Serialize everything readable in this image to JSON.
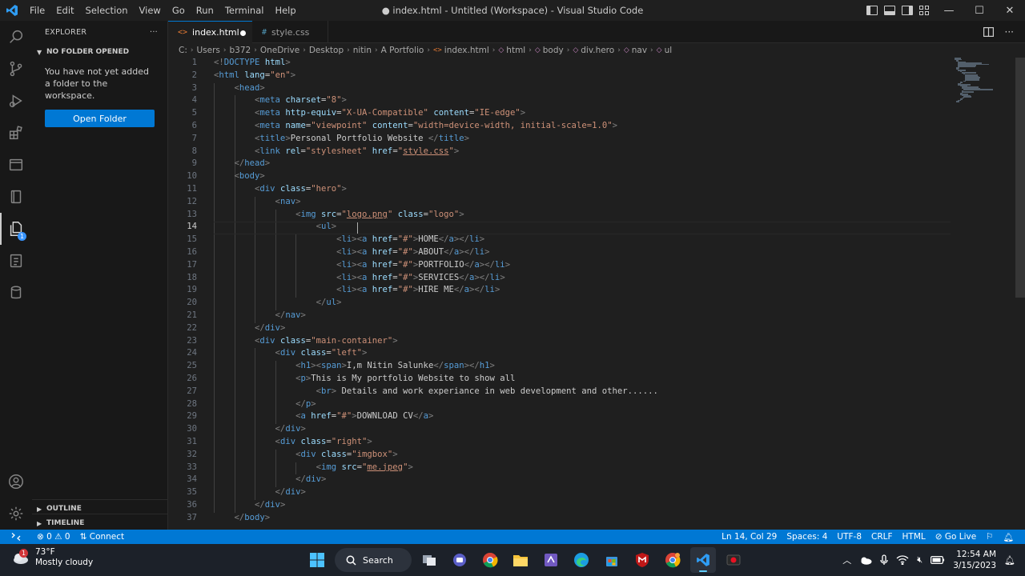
{
  "titlebar": {
    "menu": [
      "File",
      "Edit",
      "Selection",
      "View",
      "Go",
      "Run",
      "Terminal",
      "Help"
    ],
    "window_title": "● index.html - Untitled (Workspace) - Visual Studio Code",
    "minimize": "—",
    "maximize": "☐",
    "close": "✕"
  },
  "sidebar": {
    "header": "EXPLORER",
    "more": "···",
    "section": "NO FOLDER OPENED",
    "message": "You have not yet added a folder to the workspace.",
    "open_folder": "Open Folder",
    "outline": "OUTLINE",
    "timeline": "TIMELINE"
  },
  "activity": {
    "explorer_badge": "1"
  },
  "tabs": [
    {
      "icon": "<>",
      "label": "index.html"
    },
    {
      "icon": "#",
      "label": "style.css"
    }
  ],
  "breadcrumb": {
    "path": [
      "C:",
      "Users",
      "b372",
      "OneDrive",
      "Desktop",
      "nitin",
      "A Portfolio"
    ],
    "file": "index.html",
    "symbols": [
      "html",
      "body",
      "div.hero",
      "nav",
      "ul"
    ]
  },
  "editor": {
    "current_line": 14,
    "lines": [
      [
        [
          "p",
          "<!"
        ],
        [
          "t",
          "DOCTYPE"
        ],
        [
          "x",
          " "
        ],
        [
          "a",
          "html"
        ],
        [
          "p",
          ">"
        ]
      ],
      [
        [
          "p",
          "<"
        ],
        [
          "t",
          "html"
        ],
        [
          "x",
          " "
        ],
        [
          "a",
          "lang"
        ],
        [
          "x",
          "="
        ],
        [
          "s",
          "\"en\""
        ],
        [
          "p",
          ">"
        ]
      ],
      [
        [
          "x",
          "    "
        ],
        [
          "p",
          "<"
        ],
        [
          "t",
          "head"
        ],
        [
          "p",
          ">"
        ]
      ],
      [
        [
          "x",
          "        "
        ],
        [
          "p",
          "<"
        ],
        [
          "t",
          "meta"
        ],
        [
          "x",
          " "
        ],
        [
          "a",
          "charset"
        ],
        [
          "x",
          "="
        ],
        [
          "s",
          "\"8\""
        ],
        [
          "p",
          ">"
        ]
      ],
      [
        [
          "x",
          "        "
        ],
        [
          "p",
          "<"
        ],
        [
          "t",
          "meta"
        ],
        [
          "x",
          " "
        ],
        [
          "a",
          "http-equiv"
        ],
        [
          "x",
          "="
        ],
        [
          "s",
          "\"X-UA-Compatible\""
        ],
        [
          "x",
          " "
        ],
        [
          "a",
          "content"
        ],
        [
          "x",
          "="
        ],
        [
          "s",
          "\"IE-edge\""
        ],
        [
          "p",
          ">"
        ]
      ],
      [
        [
          "x",
          "        "
        ],
        [
          "p",
          "<"
        ],
        [
          "t",
          "meta"
        ],
        [
          "x",
          " "
        ],
        [
          "a",
          "name"
        ],
        [
          "x",
          "="
        ],
        [
          "s",
          "\"viewpoint\""
        ],
        [
          "x",
          " "
        ],
        [
          "a",
          "content"
        ],
        [
          "x",
          "="
        ],
        [
          "s",
          "\"width=device-width, initial-scale=1.0\""
        ],
        [
          "p",
          ">"
        ]
      ],
      [
        [
          "x",
          "        "
        ],
        [
          "p",
          "<"
        ],
        [
          "t",
          "title"
        ],
        [
          "p",
          ">"
        ],
        [
          "x",
          "Personal Portfolio Website "
        ],
        [
          "p",
          "</"
        ],
        [
          "t",
          "title"
        ],
        [
          "p",
          ">"
        ]
      ],
      [
        [
          "x",
          "        "
        ],
        [
          "p",
          "<"
        ],
        [
          "t",
          "link"
        ],
        [
          "x",
          " "
        ],
        [
          "a",
          "rel"
        ],
        [
          "x",
          "="
        ],
        [
          "s",
          "\"stylesheet\""
        ],
        [
          "x",
          " "
        ],
        [
          "a",
          "href"
        ],
        [
          "x",
          "="
        ],
        [
          "s",
          "\""
        ],
        [
          "su",
          "style.css"
        ],
        [
          "s",
          "\""
        ],
        [
          "p",
          ">"
        ]
      ],
      [
        [
          "x",
          "    "
        ],
        [
          "p",
          "</"
        ],
        [
          "t",
          "head"
        ],
        [
          "p",
          ">"
        ]
      ],
      [
        [
          "x",
          "    "
        ],
        [
          "p",
          "<"
        ],
        [
          "t",
          "body"
        ],
        [
          "p",
          ">"
        ]
      ],
      [
        [
          "x",
          "        "
        ],
        [
          "p",
          "<"
        ],
        [
          "t",
          "div"
        ],
        [
          "x",
          " "
        ],
        [
          "a",
          "class"
        ],
        [
          "x",
          "="
        ],
        [
          "s",
          "\"hero\""
        ],
        [
          "p",
          ">"
        ]
      ],
      [
        [
          "x",
          "            "
        ],
        [
          "p",
          "<"
        ],
        [
          "t",
          "nav"
        ],
        [
          "p",
          ">"
        ]
      ],
      [
        [
          "x",
          "                "
        ],
        [
          "p",
          "<"
        ],
        [
          "t",
          "img"
        ],
        [
          "x",
          " "
        ],
        [
          "a",
          "src"
        ],
        [
          "x",
          "="
        ],
        [
          "s",
          "\""
        ],
        [
          "su",
          "logo.png"
        ],
        [
          "s",
          "\""
        ],
        [
          "x",
          " "
        ],
        [
          "a",
          "class"
        ],
        [
          "x",
          "="
        ],
        [
          "s",
          "\"logo\""
        ],
        [
          "p",
          ">"
        ]
      ],
      [
        [
          "x",
          "                    "
        ],
        [
          "p",
          "<"
        ],
        [
          "t",
          "ul"
        ],
        [
          "p",
          ">"
        ]
      ],
      [
        [
          "x",
          "                        "
        ],
        [
          "p",
          "<"
        ],
        [
          "t",
          "li"
        ],
        [
          "p",
          "><"
        ],
        [
          "t",
          "a"
        ],
        [
          "x",
          " "
        ],
        [
          "a",
          "href"
        ],
        [
          "x",
          "="
        ],
        [
          "s",
          "\"#\""
        ],
        [
          "p",
          ">"
        ],
        [
          "x",
          "HOME"
        ],
        [
          "p",
          "</"
        ],
        [
          "t",
          "a"
        ],
        [
          "p",
          "></"
        ],
        [
          "t",
          "li"
        ],
        [
          "p",
          ">"
        ]
      ],
      [
        [
          "x",
          "                        "
        ],
        [
          "p",
          "<"
        ],
        [
          "t",
          "li"
        ],
        [
          "p",
          "><"
        ],
        [
          "t",
          "a"
        ],
        [
          "x",
          " "
        ],
        [
          "a",
          "href"
        ],
        [
          "x",
          "="
        ],
        [
          "s",
          "\"#\""
        ],
        [
          "p",
          ">"
        ],
        [
          "x",
          "ABOUT"
        ],
        [
          "p",
          "</"
        ],
        [
          "t",
          "a"
        ],
        [
          "p",
          "></"
        ],
        [
          "t",
          "li"
        ],
        [
          "p",
          ">"
        ]
      ],
      [
        [
          "x",
          "                        "
        ],
        [
          "p",
          "<"
        ],
        [
          "t",
          "li"
        ],
        [
          "p",
          "><"
        ],
        [
          "t",
          "a"
        ],
        [
          "x",
          " "
        ],
        [
          "a",
          "href"
        ],
        [
          "x",
          "="
        ],
        [
          "s",
          "\"#\""
        ],
        [
          "p",
          ">"
        ],
        [
          "x",
          "PORTFOLIO"
        ],
        [
          "p",
          "</"
        ],
        [
          "t",
          "a"
        ],
        [
          "p",
          "></"
        ],
        [
          "t",
          "li"
        ],
        [
          "p",
          ">"
        ]
      ],
      [
        [
          "x",
          "                        "
        ],
        [
          "p",
          "<"
        ],
        [
          "t",
          "li"
        ],
        [
          "p",
          "><"
        ],
        [
          "t",
          "a"
        ],
        [
          "x",
          " "
        ],
        [
          "a",
          "href"
        ],
        [
          "x",
          "="
        ],
        [
          "s",
          "\"#\""
        ],
        [
          "p",
          ">"
        ],
        [
          "x",
          "SERVICES"
        ],
        [
          "p",
          "</"
        ],
        [
          "t",
          "a"
        ],
        [
          "p",
          "></"
        ],
        [
          "t",
          "li"
        ],
        [
          "p",
          ">"
        ]
      ],
      [
        [
          "x",
          "                        "
        ],
        [
          "p",
          "<"
        ],
        [
          "t",
          "li"
        ],
        [
          "p",
          "><"
        ],
        [
          "t",
          "a"
        ],
        [
          "x",
          " "
        ],
        [
          "a",
          "href"
        ],
        [
          "x",
          "="
        ],
        [
          "s",
          "\"#\""
        ],
        [
          "p",
          ">"
        ],
        [
          "x",
          "HIRE ME"
        ],
        [
          "p",
          "</"
        ],
        [
          "t",
          "a"
        ],
        [
          "p",
          "></"
        ],
        [
          "t",
          "li"
        ],
        [
          "p",
          ">"
        ]
      ],
      [
        [
          "x",
          "                    "
        ],
        [
          "p",
          "</"
        ],
        [
          "t",
          "ul"
        ],
        [
          "p",
          ">"
        ]
      ],
      [
        [
          "x",
          "            "
        ],
        [
          "p",
          "</"
        ],
        [
          "t",
          "nav"
        ],
        [
          "p",
          ">"
        ]
      ],
      [
        [
          "x",
          "        "
        ],
        [
          "p",
          "</"
        ],
        [
          "t",
          "div"
        ],
        [
          "p",
          ">"
        ]
      ],
      [
        [
          "x",
          "        "
        ],
        [
          "p",
          "<"
        ],
        [
          "t",
          "div"
        ],
        [
          "x",
          " "
        ],
        [
          "a",
          "class"
        ],
        [
          "x",
          "="
        ],
        [
          "s",
          "\"main-container\""
        ],
        [
          "p",
          ">"
        ]
      ],
      [
        [
          "x",
          "            "
        ],
        [
          "p",
          "<"
        ],
        [
          "t",
          "div"
        ],
        [
          "x",
          " "
        ],
        [
          "a",
          "class"
        ],
        [
          "x",
          "="
        ],
        [
          "s",
          "\"left\""
        ],
        [
          "p",
          ">"
        ]
      ],
      [
        [
          "x",
          "                "
        ],
        [
          "p",
          "<"
        ],
        [
          "t",
          "h1"
        ],
        [
          "p",
          "><"
        ],
        [
          "t",
          "span"
        ],
        [
          "p",
          ">"
        ],
        [
          "x",
          "I,m Nitin Salunke"
        ],
        [
          "p",
          "</"
        ],
        [
          "t",
          "span"
        ],
        [
          "p",
          "></"
        ],
        [
          "t",
          "h1"
        ],
        [
          "p",
          ">"
        ]
      ],
      [
        [
          "x",
          "                "
        ],
        [
          "p",
          "<"
        ],
        [
          "t",
          "p"
        ],
        [
          "p",
          ">"
        ],
        [
          "x",
          "This is My portfolio Website to show all"
        ]
      ],
      [
        [
          "x",
          "                    "
        ],
        [
          "p",
          "<"
        ],
        [
          "t",
          "br"
        ],
        [
          "p",
          ">"
        ],
        [
          "x",
          " Details and work experiance in web development and other......"
        ]
      ],
      [
        [
          "x",
          "                "
        ],
        [
          "p",
          "</"
        ],
        [
          "t",
          "p"
        ],
        [
          "p",
          ">"
        ]
      ],
      [
        [
          "x",
          "                "
        ],
        [
          "p",
          "<"
        ],
        [
          "t",
          "a"
        ],
        [
          "x",
          " "
        ],
        [
          "a",
          "href"
        ],
        [
          "x",
          "="
        ],
        [
          "s",
          "\"#\""
        ],
        [
          "p",
          ">"
        ],
        [
          "x",
          "DOWNLOAD CV"
        ],
        [
          "p",
          "</"
        ],
        [
          "t",
          "a"
        ],
        [
          "p",
          ">"
        ]
      ],
      [
        [
          "x",
          "            "
        ],
        [
          "p",
          "</"
        ],
        [
          "t",
          "div"
        ],
        [
          "p",
          ">"
        ]
      ],
      [
        [
          "x",
          "            "
        ],
        [
          "p",
          "<"
        ],
        [
          "t",
          "div"
        ],
        [
          "x",
          " "
        ],
        [
          "a",
          "class"
        ],
        [
          "x",
          "="
        ],
        [
          "s",
          "\"right\""
        ],
        [
          "p",
          ">"
        ]
      ],
      [
        [
          "x",
          "                "
        ],
        [
          "p",
          "<"
        ],
        [
          "t",
          "div"
        ],
        [
          "x",
          " "
        ],
        [
          "a",
          "class"
        ],
        [
          "x",
          "="
        ],
        [
          "s",
          "\"imgbox\""
        ],
        [
          "p",
          ">"
        ]
      ],
      [
        [
          "x",
          "                    "
        ],
        [
          "p",
          "<"
        ],
        [
          "t",
          "img"
        ],
        [
          "x",
          " "
        ],
        [
          "a",
          "src"
        ],
        [
          "x",
          "="
        ],
        [
          "s",
          "\""
        ],
        [
          "su",
          "me.jpeg"
        ],
        [
          "s",
          "\""
        ],
        [
          "p",
          ">"
        ]
      ],
      [
        [
          "x",
          "                "
        ],
        [
          "p",
          "</"
        ],
        [
          "t",
          "div"
        ],
        [
          "p",
          ">"
        ]
      ],
      [
        [
          "x",
          "            "
        ],
        [
          "p",
          "</"
        ],
        [
          "t",
          "div"
        ],
        [
          "p",
          ">"
        ]
      ],
      [
        [
          "x",
          "        "
        ],
        [
          "p",
          "</"
        ],
        [
          "t",
          "div"
        ],
        [
          "p",
          ">"
        ]
      ],
      [
        [
          "x",
          "    "
        ],
        [
          "p",
          "</"
        ],
        [
          "t",
          "body"
        ],
        [
          "p",
          ">"
        ]
      ]
    ]
  },
  "statusbar": {
    "problems": "⊗ 0 ⚠ 0",
    "connect": "Connect",
    "position": "Ln 14, Col 29",
    "spaces": "Spaces: 4",
    "encoding": "UTF-8",
    "eol": "CRLF",
    "language": "HTML",
    "golive": "Go Live"
  },
  "taskbar": {
    "temperature": "73°F",
    "weather": "Mostly cloudy",
    "weather_badge": "1",
    "search": "Search",
    "time": "12:54 AM",
    "date": "3/15/2023"
  },
  "colors": {
    "accent": "#0078d4",
    "editor_bg": "#1f1f1f",
    "sidebar_bg": "#181818",
    "tag": "#569cd6",
    "attr": "#9cdcfe",
    "string": "#ce9178"
  }
}
